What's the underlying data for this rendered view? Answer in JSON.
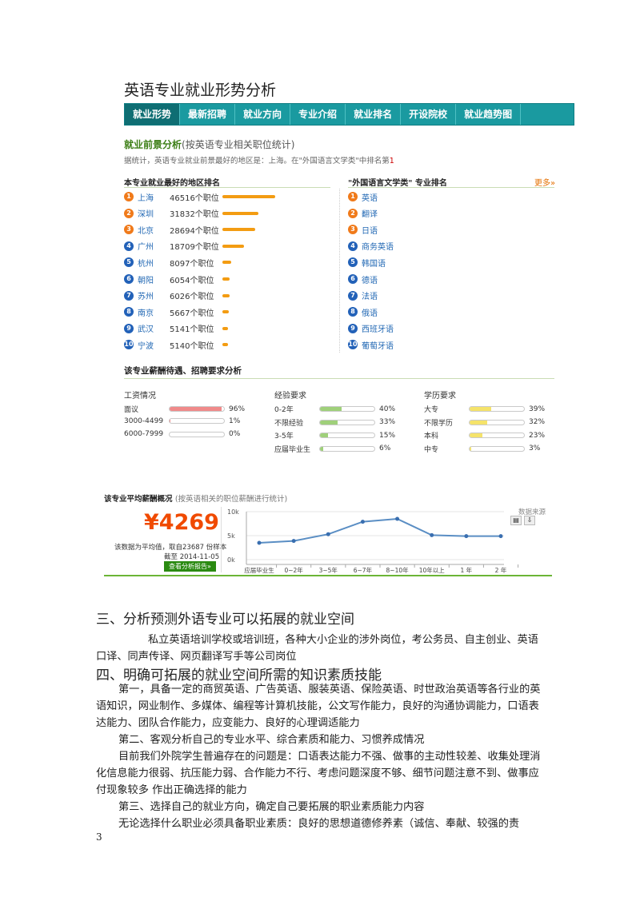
{
  "page_title": "英语专业就业形势分析",
  "nav": [
    "就业形势",
    "最新招聘",
    "就业方向",
    "专业介绍",
    "就业排名",
    "开设院校",
    "就业趋势图"
  ],
  "prospect": {
    "heading": "就业前景分析",
    "heading_sub": "(按英语专业相关职位统计)",
    "note": "据统计，英语专业就业前景最好的地区是：上海。在\"外国语言文学类\"中排名第",
    "rank": "1"
  },
  "regions": {
    "heading": "本专业就业最好的地区排名",
    "items": [
      {
        "n": "1",
        "city": "上海",
        "count": "46516个职位",
        "value": 46516
      },
      {
        "n": "2",
        "city": "深圳",
        "count": "31832个职位",
        "value": 31832
      },
      {
        "n": "3",
        "city": "北京",
        "count": "28694个职位",
        "value": 28694
      },
      {
        "n": "4",
        "city": "广州",
        "count": "18709个职位",
        "value": 18709
      },
      {
        "n": "5",
        "city": "杭州",
        "count": "8097个职位",
        "value": 8097
      },
      {
        "n": "6",
        "city": "朝阳",
        "count": "6054个职位",
        "value": 6054
      },
      {
        "n": "7",
        "city": "苏州",
        "count": "6026个职位",
        "value": 6026
      },
      {
        "n": "8",
        "city": "南京",
        "count": "5667个职位",
        "value": 5667
      },
      {
        "n": "9",
        "city": "武汉",
        "count": "5141个职位",
        "value": 5141
      },
      {
        "n": "10",
        "city": "宁波",
        "count": "5140个职位",
        "value": 5140
      }
    ]
  },
  "majors": {
    "heading": "\"外国语言文学类\" 专业排名",
    "more": "更多»",
    "items": [
      {
        "n": "1",
        "name": "英语"
      },
      {
        "n": "2",
        "name": "翻译"
      },
      {
        "n": "3",
        "name": "日语"
      },
      {
        "n": "4",
        "name": "商务英语"
      },
      {
        "n": "5",
        "name": "韩国语"
      },
      {
        "n": "6",
        "name": "德语"
      },
      {
        "n": "7",
        "name": "法语"
      },
      {
        "n": "8",
        "name": "俄语"
      },
      {
        "n": "9",
        "name": "西班牙语"
      },
      {
        "n": "10",
        "name": "葡萄牙语"
      }
    ]
  },
  "requirements": {
    "heading": "该专业薪酬待遇、招聘要求分析",
    "salary": {
      "title": "工资情况",
      "color": "#f08a8a",
      "items": [
        {
          "label": "面议",
          "pct": "96%",
          "value": 96
        },
        {
          "label": "3000-4499",
          "pct": "1%",
          "value": 1
        },
        {
          "label": "6000-7999",
          "pct": "0%",
          "value": 0
        }
      ]
    },
    "experience": {
      "title": "经验要求",
      "color": "#9fd07a",
      "items": [
        {
          "label": "0-2年",
          "pct": "40%",
          "value": 40
        },
        {
          "label": "不限经验",
          "pct": "33%",
          "value": 33
        },
        {
          "label": "3-5年",
          "pct": "15%",
          "value": 15
        },
        {
          "label": "应届毕业生",
          "pct": "6%",
          "value": 6
        }
      ]
    },
    "education": {
      "title": "学历要求",
      "color": "#f5e36a",
      "items": [
        {
          "label": "大专",
          "pct": "39%",
          "value": 39
        },
        {
          "label": "不限学历",
          "pct": "32%",
          "value": 32
        },
        {
          "label": "本科",
          "pct": "23%",
          "value": 23
        },
        {
          "label": "中专",
          "pct": "3%",
          "value": 3
        }
      ]
    }
  },
  "avg_salary": {
    "heading": "该专业平均薪酬概况",
    "heading_sub": "(按英语相关的职位薪酬进行统计)",
    "price": "¥4269",
    "note1": "该数据为平均值，取自23687 份样本",
    "note2": "截至 2014-11-05",
    "button": "查看分析报告»",
    "source_label": "数据来源"
  },
  "chart_data": {
    "type": "line",
    "categories": [
      "应届毕业生",
      "0~2年",
      "3~5年",
      "6~7年",
      "8~10年",
      "10年以上",
      "1 年",
      "2 年"
    ],
    "series": [
      {
        "values": [
          3500,
          3900,
          5300,
          7900,
          8500,
          5100,
          4900,
          4900
        ]
      }
    ],
    "y_ticks": [
      "10k",
      "5k",
      "0k"
    ],
    "ylim": [
      0,
      10000
    ],
    "grid": true
  },
  "section3": {
    "heading": "三、分析预测外语专业可以拓展的就业空间",
    "para": "私立英语培训学校或培训班，各种大小企业的涉外岗位，考公务员、自主创业、英语口译、同声传译、网页翻译写手等公司岗位"
  },
  "section4": {
    "heading": "四、明确可拓展的就业空间所需的知识素质技能",
    "p1": "第一，具备一定的商贸英语、广告英语、服装英语、保险英语、时世政治英语等各行业的英语知识，网业制作、多媒体、编程等计算机技能，公文写作能力，良好的沟通协调能力，口语表达能力、团队合作能力，应变能力、良好的心理调适能力",
    "p2": "第二、客观分析自己的专业水平、综合素质和能力、习惯养成情况",
    "p3": "目前我们外院学生普遍存在的问题是：口语表达能力不强、做事的主动性较差、收集处理消化信息能力很弱、抗压能力弱、合作能力不行、考虑问题深度不够、细节问题注意不到、做事应付现象较多 作出正确选择的能力",
    "p4": "第三、选择自己的就业方向，确定自己要拓展的职业素质能力内容",
    "p5": "无论选择什么职业必须具备职业素质：良好的思想道德修养素（诚信、奉献、较强的责"
  },
  "page_number": "3",
  "colors": {
    "nav": "#1a9aa0",
    "accent_orange": "#f39c12",
    "price": "#f04a00",
    "line": "#5a8ec4",
    "green": "#3d7f17"
  }
}
